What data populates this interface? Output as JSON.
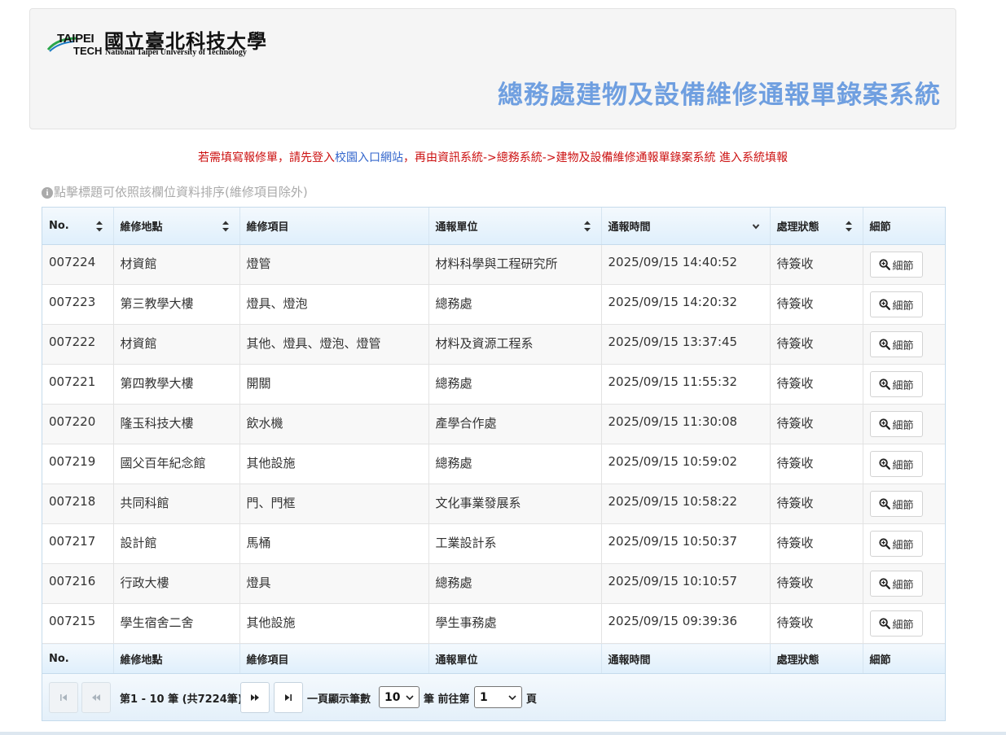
{
  "header": {
    "logo": {
      "taipei": "TAIPEI",
      "tech": "TECH",
      "chinese_name": "國立臺北科技大學",
      "english_name": "National Taipei University of Technology"
    },
    "system_title": "總務處建物及設備維修通報單錄案系統"
  },
  "notice": {
    "prefix": "若需填寫報修單，請先登入",
    "link": "校園入口網站",
    "suffix": "，再由資訊系統->總務系統->建物及設備維修通報單錄案系統 進入系統填報"
  },
  "hint": "點擊標題可依照該欄位資料排序(維修項目除外)",
  "table": {
    "columns": [
      "No.",
      "維修地點",
      "維修項目",
      "通報單位",
      "通報時間",
      "處理狀態",
      "細節"
    ],
    "detail_label": "細節",
    "rows": [
      {
        "no": "007224",
        "location": "材資館",
        "item": "燈管",
        "unit": "材料科學與工程研究所",
        "time": "2025/09/15 14:40:52",
        "status": "待簽收"
      },
      {
        "no": "007223",
        "location": "第三教學大樓",
        "item": "燈具、燈泡",
        "unit": "總務處",
        "time": "2025/09/15 14:20:32",
        "status": "待簽收"
      },
      {
        "no": "007222",
        "location": "材資館",
        "item": "其他、燈具、燈泡、燈管",
        "unit": "材料及資源工程系",
        "time": "2025/09/15 13:37:45",
        "status": "待簽收"
      },
      {
        "no": "007221",
        "location": "第四教學大樓",
        "item": "開關",
        "unit": "總務處",
        "time": "2025/09/15 11:55:32",
        "status": "待簽收"
      },
      {
        "no": "007220",
        "location": "隆玉科技大樓",
        "item": "飲水機",
        "unit": "產學合作處",
        "time": "2025/09/15 11:30:08",
        "status": "待簽收"
      },
      {
        "no": "007219",
        "location": "國父百年紀念館",
        "item": "其他設施",
        "unit": "總務處",
        "time": "2025/09/15 10:59:02",
        "status": "待簽收"
      },
      {
        "no": "007218",
        "location": "共同科館",
        "item": "門、門框",
        "unit": "文化事業發展系",
        "time": "2025/09/15 10:58:22",
        "status": "待簽收"
      },
      {
        "no": "007217",
        "location": "設計館",
        "item": "馬桶",
        "unit": "工業設計系",
        "time": "2025/09/15 10:50:37",
        "status": "待簽收"
      },
      {
        "no": "007216",
        "location": "行政大樓",
        "item": "燈具",
        "unit": "總務處",
        "time": "2025/09/15 10:10:57",
        "status": "待簽收"
      },
      {
        "no": "007215",
        "location": "學生宿舍二舍",
        "item": "其他設施",
        "unit": "學生事務處",
        "time": "2025/09/15 09:39:36",
        "status": "待簽收"
      }
    ]
  },
  "pager": {
    "range_text": "第1 - 10 筆 (共7224筆)",
    "page_size_label": "一頁顯示筆數",
    "page_size_value": "10",
    "goto_label": "筆 前往第",
    "page_value": "1",
    "page_suffix": "頁"
  },
  "colors": {
    "title": "#6f9fe0",
    "notice": "#cc1111",
    "link": "#3366cc",
    "header_bg": "#dfeffc"
  }
}
